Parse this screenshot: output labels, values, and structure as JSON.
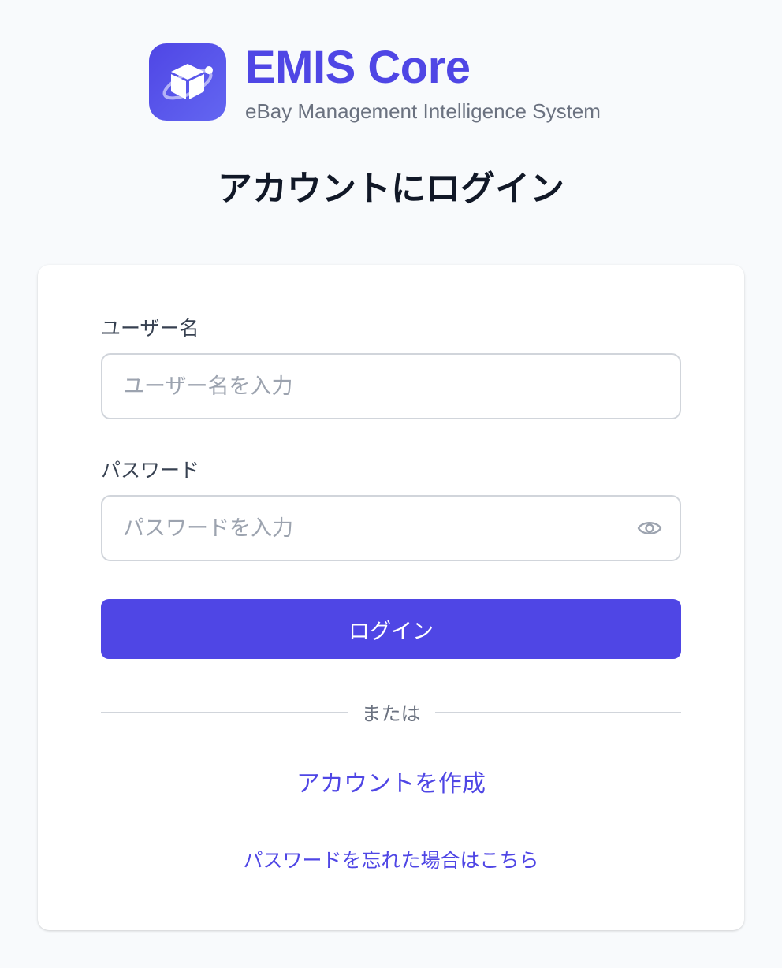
{
  "brand": {
    "name": "EMIS Core",
    "subtitle": "eBay Management Intelligence System",
    "logo_icon": "package-orbit-icon",
    "accent_color": "#4f46e5"
  },
  "heading": "アカウントにログイン",
  "form": {
    "username": {
      "label": "ユーザー名",
      "placeholder": "ユーザー名を入力",
      "value": ""
    },
    "password": {
      "label": "パスワード",
      "placeholder": "パスワードを入力",
      "value": "",
      "toggle_icon": "eye-icon"
    },
    "submit_label": "ログイン"
  },
  "divider_text": "または",
  "links": {
    "create_account": "アカウントを作成",
    "forgot_password": "パスワードを忘れた場合はこちら"
  }
}
